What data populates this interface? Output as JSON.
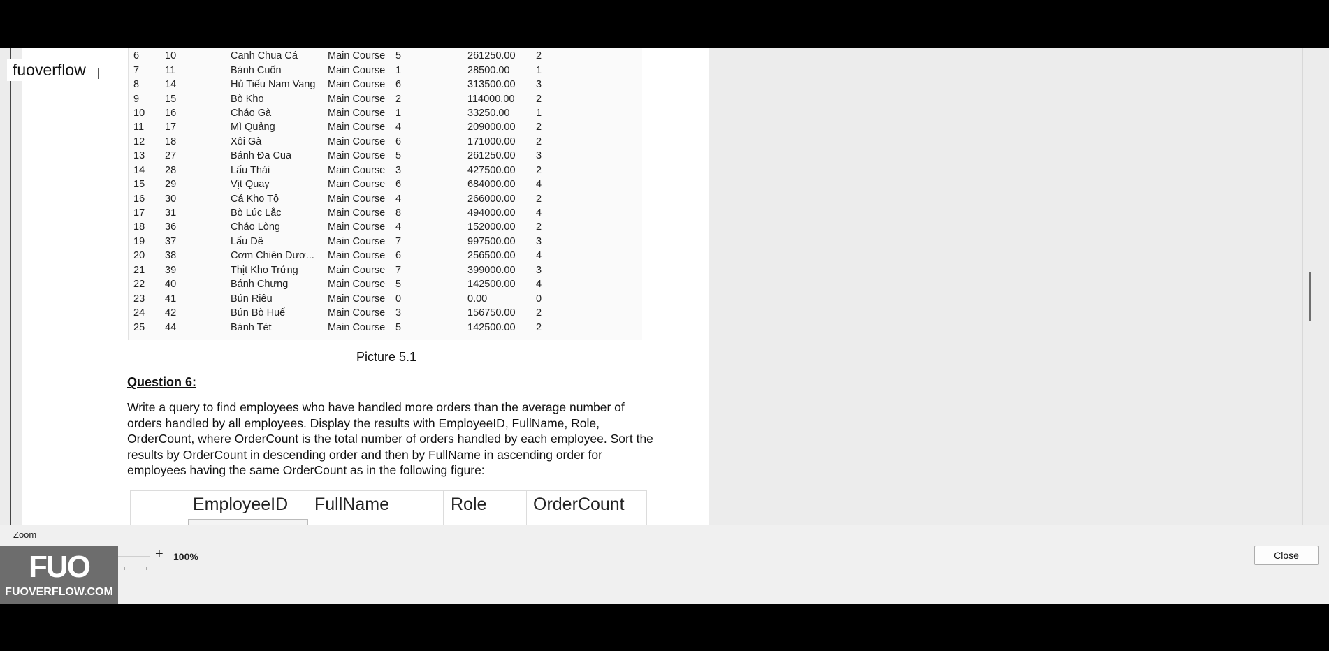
{
  "watermark": "fuoverflow",
  "table_rows": [
    [
      "6",
      "10",
      "Canh Chua Cá",
      "Main Course",
      "5",
      "261250.00",
      "2"
    ],
    [
      "7",
      "11",
      "Bánh Cuốn",
      "Main Course",
      "1",
      "28500.00",
      "1"
    ],
    [
      "8",
      "14",
      "Hủ Tiếu Nam Vang",
      "Main Course",
      "6",
      "313500.00",
      "3"
    ],
    [
      "9",
      "15",
      "Bò Kho",
      "Main Course",
      "2",
      "114000.00",
      "2"
    ],
    [
      "10",
      "16",
      "Cháo Gà",
      "Main Course",
      "1",
      "33250.00",
      "1"
    ],
    [
      "11",
      "17",
      "Mì Quảng",
      "Main Course",
      "4",
      "209000.00",
      "2"
    ],
    [
      "12",
      "18",
      "Xôi Gà",
      "Main Course",
      "6",
      "171000.00",
      "2"
    ],
    [
      "13",
      "27",
      "Bánh Đa Cua",
      "Main Course",
      "5",
      "261250.00",
      "3"
    ],
    [
      "14",
      "28",
      "Lẩu Thái",
      "Main Course",
      "3",
      "427500.00",
      "2"
    ],
    [
      "15",
      "29",
      "Vịt Quay",
      "Main Course",
      "6",
      "684000.00",
      "4"
    ],
    [
      "16",
      "30",
      "Cá Kho Tộ",
      "Main Course",
      "4",
      "266000.00",
      "2"
    ],
    [
      "17",
      "31",
      "Bò Lúc Lắc",
      "Main Course",
      "8",
      "494000.00",
      "4"
    ],
    [
      "18",
      "36",
      "Cháo Lòng",
      "Main Course",
      "4",
      "152000.00",
      "2"
    ],
    [
      "19",
      "37",
      "Lẩu Dê",
      "Main Course",
      "7",
      "997500.00",
      "3"
    ],
    [
      "20",
      "38",
      "Cơm Chiên Dươ...",
      "Main Course",
      "6",
      "256500.00",
      "4"
    ],
    [
      "21",
      "39",
      "Thịt Kho Trứng",
      "Main Course",
      "7",
      "399000.00",
      "3"
    ],
    [
      "22",
      "40",
      "Bánh Chưng",
      "Main Course",
      "5",
      "142500.00",
      "4"
    ],
    [
      "23",
      "41",
      "Bún Riêu",
      "Main Course",
      "0",
      "0.00",
      "0"
    ],
    [
      "24",
      "42",
      "Bún Bò Huế",
      "Main Course",
      "3",
      "156750.00",
      "2"
    ],
    [
      "25",
      "44",
      "Bánh Tét",
      "Main Course",
      "5",
      "142500.00",
      "2"
    ]
  ],
  "caption": "Picture 5.1",
  "question": {
    "heading": "Question 6:",
    "body": "Write a query to find employees who have handled more orders than the average number of orders handled by all employees. Display the results with EmployeeID, FullName, Role, OrderCount, where OrderCount is the total number of orders handled by each employee. Sort the results by OrderCount in descending order and then by FullName in ascending order for employees having the same OrderCount as in the following figure:"
  },
  "employee_table_headers": [
    "EmployeeID",
    "FullName",
    "Role",
    "OrderCount"
  ],
  "zoom": {
    "label": "Zoom",
    "minus": "-",
    "plus": "+",
    "value": "100%",
    "level_percent": 100
  },
  "close_label": "Close",
  "logo": {
    "mark": "FUO",
    "text": "FUOVERFLOW.COM"
  },
  "colors": {
    "accent": "#1e5aa8",
    "background": "#000000",
    "panel": "#f0f0f0"
  }
}
